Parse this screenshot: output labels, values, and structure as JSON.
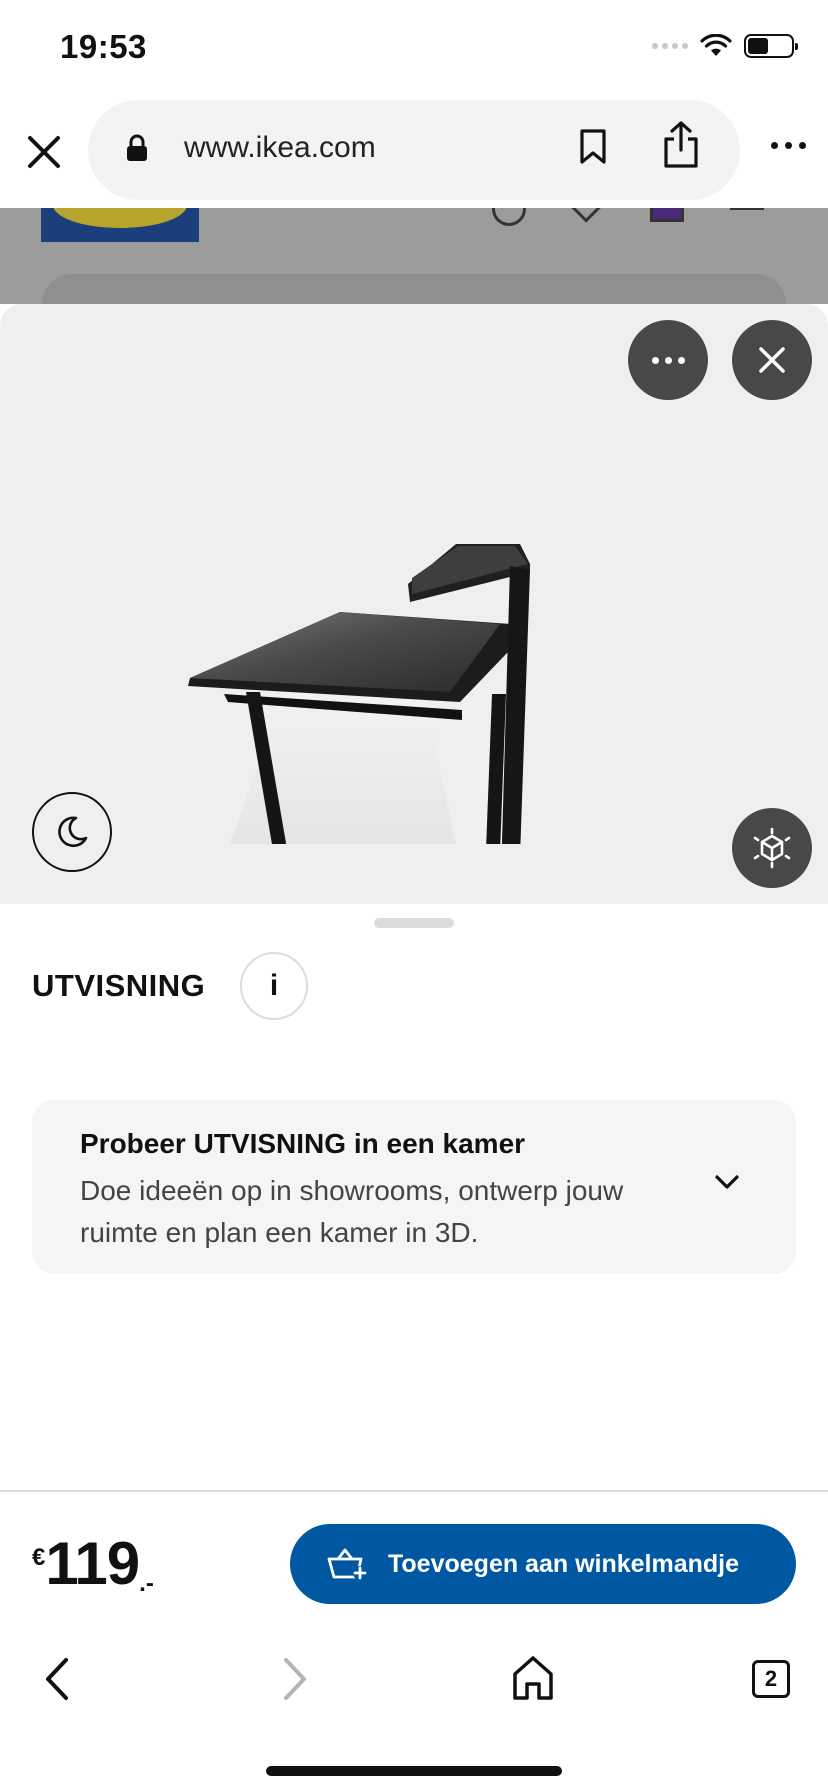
{
  "status_bar": {
    "time": "19:53"
  },
  "browser": {
    "url": "www.ikea.com",
    "tab_count": "2"
  },
  "viewer": {
    "controls": [
      "more-options",
      "close",
      "night-mode",
      "view-in-ar"
    ]
  },
  "product": {
    "name": "UTVISNING",
    "info_label": "i",
    "promo": {
      "title": "Probeer UTVISNING in een kamer",
      "description": "Doe ideeën op in showrooms, ontwerp jouw ruimte en plan een kamer in 3D."
    },
    "price": {
      "currency": "€",
      "integer": "119",
      "decimal": ".-"
    },
    "add_to_cart_label": "Toevoegen aan winkelmandje"
  },
  "colors": {
    "accent_blue": "#0058a3",
    "viewer_bg": "#efefef",
    "dark_button": "#484848"
  }
}
